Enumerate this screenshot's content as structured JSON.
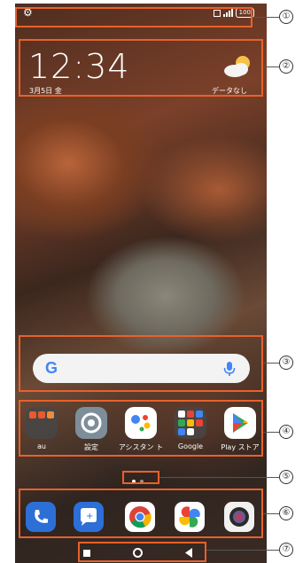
{
  "status_bar": {
    "battery": "100",
    "icons": [
      "settings-gear-icon",
      "sim-icon",
      "signal-icon",
      "battery-icon"
    ]
  },
  "clock_widget": {
    "time": "12:34",
    "date": "3月5日 金"
  },
  "weather_widget": {
    "icon": "partly-cloudy-icon",
    "text": "データなし"
  },
  "search_bar": {
    "logo": "G",
    "icon": "mic-icon"
  },
  "apps": [
    {
      "label": "au",
      "icon": "au-folder-icon"
    },
    {
      "label": "設定",
      "icon": "settings-icon"
    },
    {
      "label": "アシスタン\nト",
      "icon": "assistant-icon"
    },
    {
      "label": "Google",
      "icon": "google-folder-icon"
    },
    {
      "label": "Play ストア",
      "icon": "play-store-icon"
    }
  ],
  "page_indicator": {
    "pages": 2,
    "current": 1
  },
  "dock": [
    {
      "icon": "phone-icon"
    },
    {
      "icon": "messages-icon"
    },
    {
      "icon": "chrome-icon"
    },
    {
      "icon": "photos-icon"
    },
    {
      "icon": "camera-icon"
    }
  ],
  "nav_bar": {
    "icons": [
      "recents-square-icon",
      "home-circle-icon",
      "back-triangle-icon"
    ]
  },
  "callouts": {
    "n1": "①",
    "n2": "②",
    "n3": "③",
    "n4": "④",
    "n5": "⑤",
    "n6": "⑥",
    "n7": "⑦"
  },
  "colors": {
    "callout_border": "#e8612c"
  }
}
